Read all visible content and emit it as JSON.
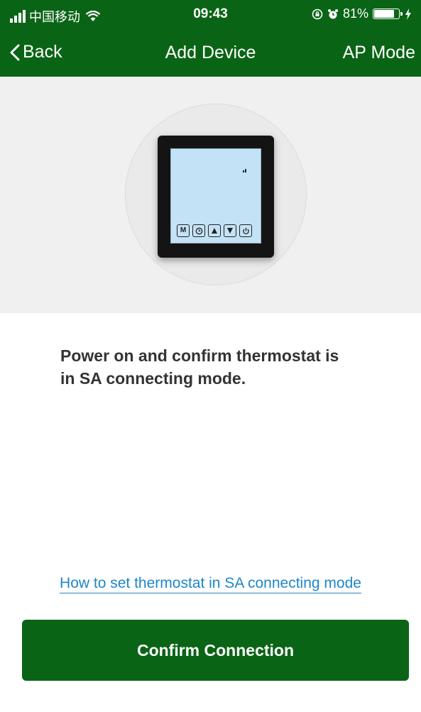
{
  "status_bar": {
    "carrier": "中国移动",
    "time": "09:43",
    "battery": "81%",
    "battery_level": 0.81,
    "icons": [
      "signal-icon",
      "wifi-icon",
      "rotation-lock-icon",
      "alarm-icon",
      "battery-icon",
      "charging-icon"
    ]
  },
  "nav": {
    "back_label": "Back",
    "title": "Add Device",
    "right_label": "AP Mode",
    "back_icon": "chevron-left-icon"
  },
  "hero": {
    "device_buttons": [
      "M",
      "clock",
      "up",
      "down",
      "power"
    ]
  },
  "instruction": {
    "line1": "Power on and confirm thermostat is",
    "line2": "in SA connecting mode."
  },
  "help_link": "How to set thermostat in SA connecting mode",
  "confirm_button": "Confirm Connection",
  "colors": {
    "brand_green": "#0a6415",
    "link_blue": "#1f86c8",
    "hero_background": "#f0f0f0",
    "text_dark": "#333333"
  }
}
